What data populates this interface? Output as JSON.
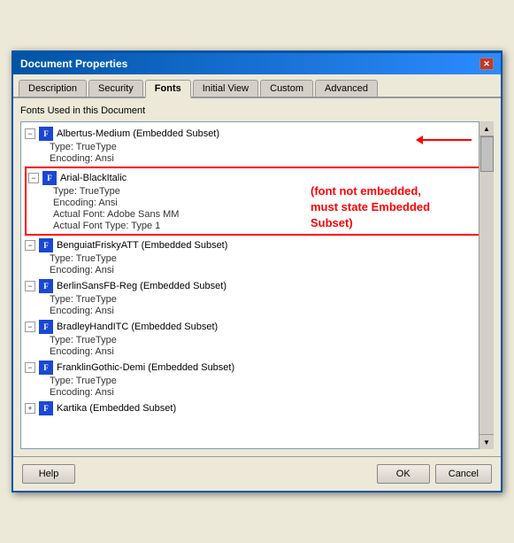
{
  "dialog": {
    "title": "Document Properties",
    "close_btn": "✕"
  },
  "tabs": [
    {
      "id": "description",
      "label": "Description",
      "active": false
    },
    {
      "id": "security",
      "label": "Security",
      "active": false
    },
    {
      "id": "fonts",
      "label": "Fonts",
      "active": true
    },
    {
      "id": "initial-view",
      "label": "Initial View",
      "active": false
    },
    {
      "id": "custom",
      "label": "Custom",
      "active": false
    },
    {
      "id": "advanced",
      "label": "Advanced",
      "active": false
    }
  ],
  "section_label": "Fonts Used in this Document",
  "fonts": [
    {
      "name": "Albertus-Medium (Embedded Subset)",
      "highlighted": false,
      "arrow": true,
      "children": [
        {
          "label": "Type: TrueType"
        },
        {
          "label": "Encoding: Ansi"
        }
      ]
    },
    {
      "name": "Arial-BlackItalic",
      "highlighted": true,
      "arrow": false,
      "children": [
        {
          "label": "Type: TrueType"
        },
        {
          "label": "Encoding: Ansi"
        },
        {
          "label": "Actual Font: Adobe Sans MM"
        },
        {
          "label": "Actual Font Type: Type 1"
        }
      ]
    },
    {
      "name": "BenguiatFriskyATT (Embedded Subset)",
      "highlighted": false,
      "arrow": false,
      "children": [
        {
          "label": "Type: TrueType"
        },
        {
          "label": "Encoding: Ansi"
        }
      ]
    },
    {
      "name": "BerlinSansFB-Reg (Embedded Subset)",
      "highlighted": false,
      "arrow": false,
      "children": [
        {
          "label": "Type: TrueType"
        },
        {
          "label": "Encoding: Ansi"
        }
      ]
    },
    {
      "name": "BradleyHandITC (Embedded Subset)",
      "highlighted": false,
      "arrow": false,
      "children": [
        {
          "label": "Type: TrueType"
        },
        {
          "label": "Encoding: Ansi"
        }
      ]
    },
    {
      "name": "FranklinGothic-Demi (Embedded Subset)",
      "highlighted": false,
      "arrow": false,
      "children": [
        {
          "label": "Type: TrueType"
        },
        {
          "label": "Encoding: Ansi"
        }
      ]
    },
    {
      "name": "Kartika (Embedded Subset)",
      "highlighted": false,
      "arrow": false,
      "children": []
    }
  ],
  "annotation": {
    "line1": "(font not embedded,",
    "line2": "must state Embedded Subset)"
  },
  "buttons": {
    "help": "Help",
    "ok": "OK",
    "cancel": "Cancel"
  }
}
